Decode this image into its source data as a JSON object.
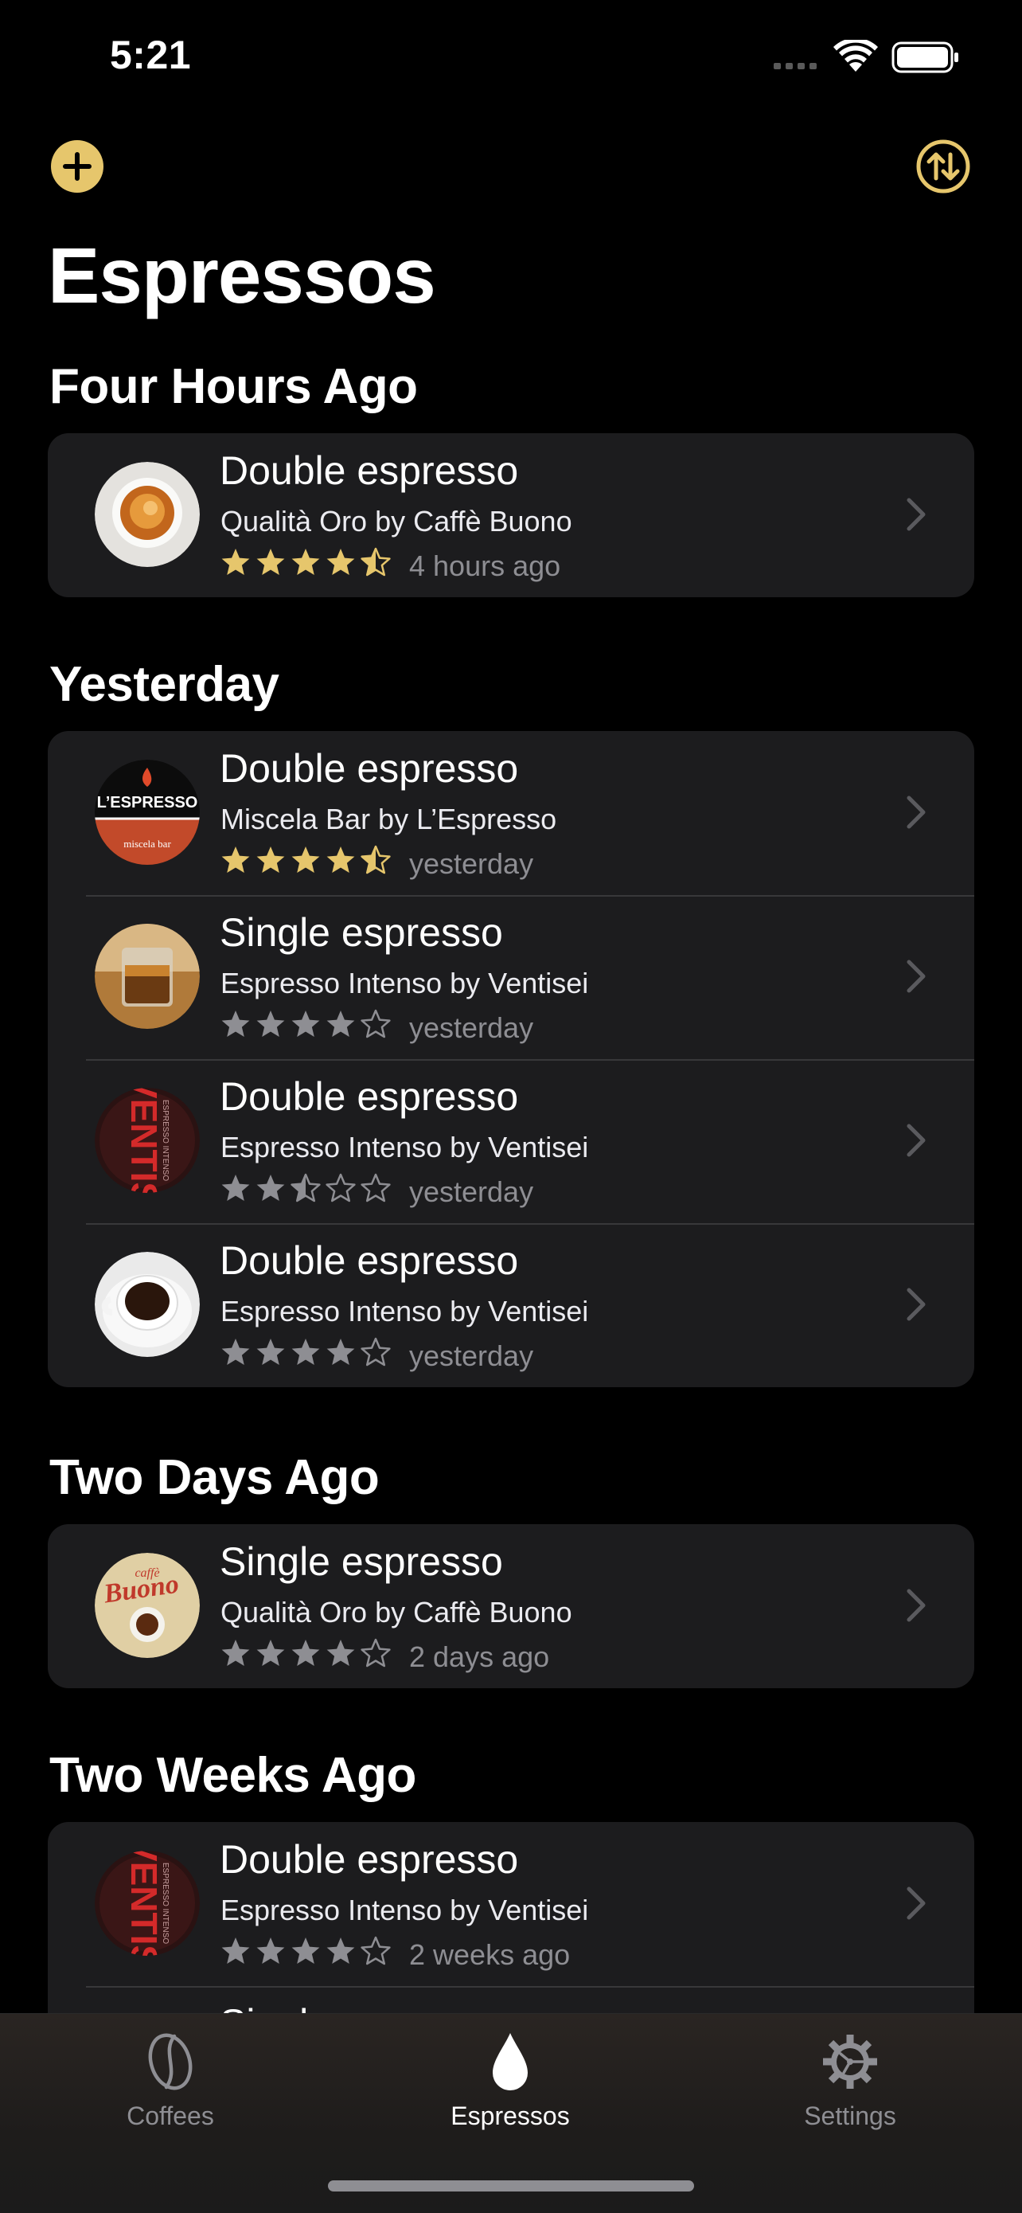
{
  "status_bar": {
    "time": "5:21"
  },
  "toolbar": {
    "add_icon": "plus-circle-icon",
    "sort_icon": "sort-arrows-icon",
    "accent": "#E6C66C"
  },
  "page_title": "Espressos",
  "sections": [
    {
      "header": "Four Hours Ago",
      "rows": [
        {
          "title": "Double espresso",
          "subtitle": "Qualità Oro by Caffè Buono",
          "rating": 4.5,
          "time": "4 hours ago",
          "thumb": "espresso-crema-photo"
        }
      ]
    },
    {
      "header": "Yesterday",
      "rows": [
        {
          "title": "Double espresso",
          "subtitle": "Miscela Bar by L’Espresso",
          "rating": 4.5,
          "time": "yesterday",
          "thumb": "lespresso-logo"
        },
        {
          "title": "Single espresso",
          "subtitle": "Espresso Intenso by Ventisei",
          "rating": 4,
          "time": "yesterday",
          "thumb": "glass-espresso-photo"
        },
        {
          "title": "Double espresso",
          "subtitle": "Espresso Intenso by Ventisei",
          "rating": 2.5,
          "time": "yesterday",
          "thumb": "ventisei-label"
        },
        {
          "title": "Double espresso",
          "subtitle": "Espresso Intenso by Ventisei",
          "rating": 4,
          "time": "yesterday",
          "thumb": "white-cup-photo"
        }
      ]
    },
    {
      "header": "Two Days Ago",
      "rows": [
        {
          "title": "Single espresso",
          "subtitle": "Qualità Oro by Caffè Buono",
          "rating": 4,
          "time": "2 days ago",
          "thumb": "caffe-buono-label"
        }
      ]
    },
    {
      "header": "Two Weeks Ago",
      "rows": [
        {
          "title": "Double espresso",
          "subtitle": "Espresso Intenso by Ventisei",
          "rating": 4,
          "time": "2 weeks ago",
          "thumb": "ventisei-label"
        },
        {
          "title": "Single espresso",
          "subtitle": "",
          "rating": 0,
          "time": "",
          "thumb": ""
        }
      ]
    }
  ],
  "thumb_text": {
    "lespresso_brand": "L’ESPRESSO",
    "lespresso_sub": "miscela bar",
    "ventisei_brand": "VENTIS",
    "ventisei_sub": "ESPRESSO INTENSO",
    "buono_caffe": "caffè",
    "buono_brand": "Buono"
  },
  "tabs": [
    {
      "label": "Coffees",
      "icon": "coffee-bean-icon",
      "active": false
    },
    {
      "label": "Espressos",
      "icon": "drop-icon",
      "active": true
    },
    {
      "label": "Settings",
      "icon": "gear-icon",
      "active": false
    }
  ],
  "colors": {
    "star_filled_top": "#E6C66C",
    "star_gray": "#8E8E93",
    "card": "#1C1C1E"
  }
}
